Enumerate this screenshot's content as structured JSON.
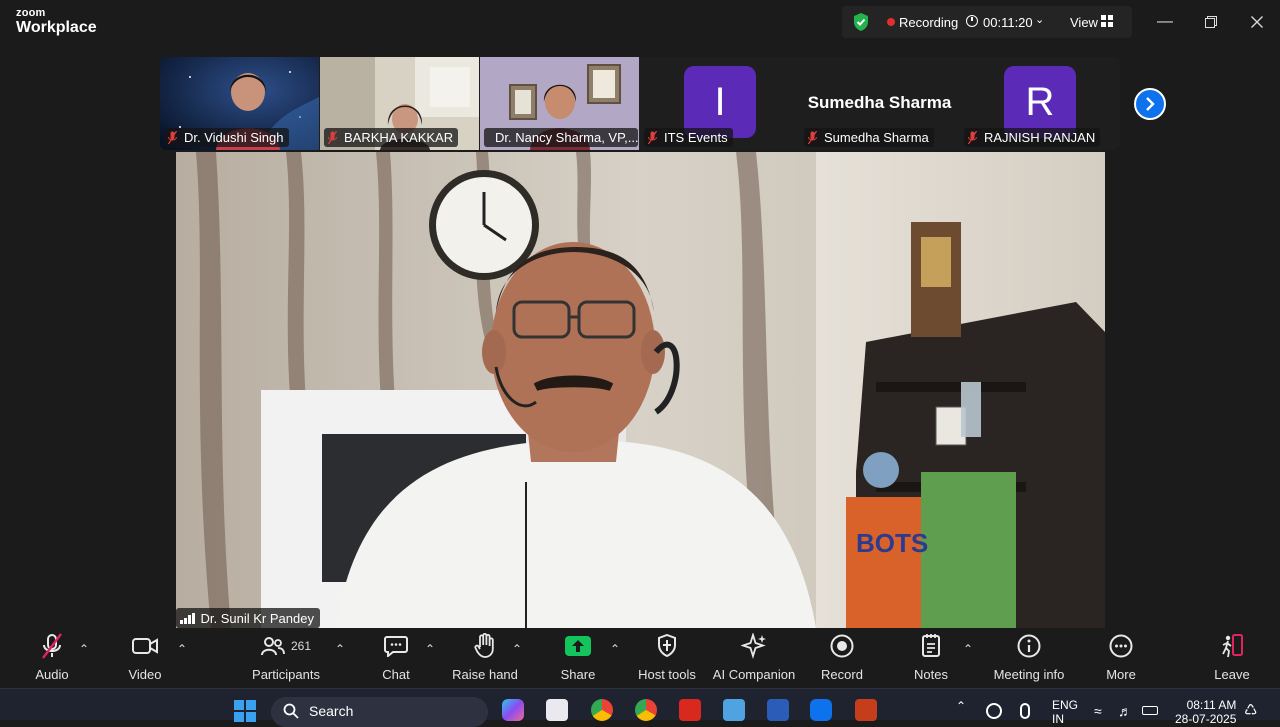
{
  "app": {
    "brand_small": "zoom",
    "brand_large": "Workplace"
  },
  "status": {
    "recording_label": "Recording",
    "timer": "00:11:20",
    "view_label": "View"
  },
  "gallery": [
    {
      "name": "Dr. Vidushi Singh",
      "type": "video"
    },
    {
      "name": "BARKHA KAKKAR",
      "type": "video"
    },
    {
      "name": "Dr. Nancy Sharma, VP,...",
      "type": "video"
    },
    {
      "name": "ITS Events",
      "type": "avatar",
      "initial": "I"
    },
    {
      "name": "Sumedha Sharma",
      "type": "name",
      "display": "Sumedha Sharma"
    },
    {
      "name": "RAJNISH RANJAN",
      "type": "avatar",
      "initial": "R"
    }
  ],
  "speaker": {
    "name": "Dr. Sunil Kr Pandey"
  },
  "toolbar": {
    "audio": "Audio",
    "video": "Video",
    "participants": "Participants",
    "participants_count": "261",
    "chat": "Chat",
    "raise_hand": "Raise hand",
    "share": "Share",
    "host_tools": "Host tools",
    "ai_companion": "AI Companion",
    "record": "Record",
    "notes": "Notes",
    "meeting_info": "Meeting info",
    "more": "More",
    "leave": "Leave"
  },
  "taskbar": {
    "search_placeholder": "Search",
    "lang_top": "ENG",
    "lang_bottom": "IN",
    "time": "08:11 AM",
    "date": "28-07-2025"
  },
  "colors": {
    "accent": "#0e72ed",
    "avatar": "#5b2bb7",
    "share": "#12c45b",
    "recording": "#e02f2f"
  }
}
